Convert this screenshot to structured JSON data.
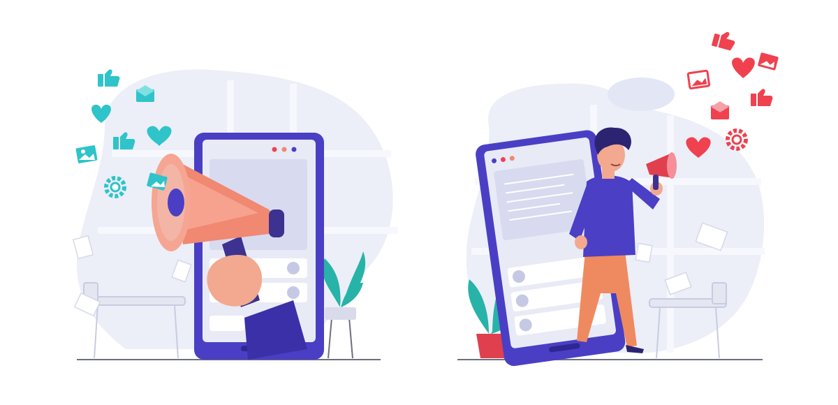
{
  "scene": {
    "left_panel": {
      "subject": "hand-holding-megaphone-from-phone",
      "icons": [
        "thumbs-up-icon",
        "mail-icon",
        "heart-icon",
        "image-icon",
        "gear-icon"
      ],
      "icon_color": "#2ec4c9"
    },
    "right_panel": {
      "subject": "man-with-megaphone-stepping-out-of-phone",
      "icons": [
        "thumbs-up-icon",
        "image-icon",
        "heart-icon",
        "mail-icon",
        "gear-icon"
      ],
      "icon_color": "#f0414f"
    }
  },
  "colors": {
    "background": "#ffffff",
    "blob": "#eceef8",
    "phone_frame": "#4a3fc4",
    "phone_screen": "#e8eaf6",
    "megaphone": "#f08872",
    "skin": "#f2a98f",
    "shirt": "#4b3fc6",
    "pants": "#ef8a60",
    "plant": "#27b3a8",
    "pot": "#e0404e",
    "ground_line": "#6d6f80"
  }
}
